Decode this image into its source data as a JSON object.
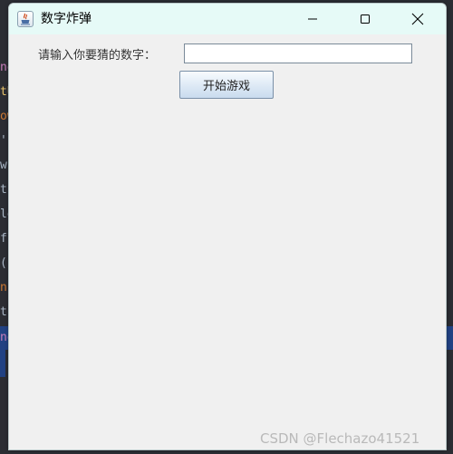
{
  "window": {
    "title": "数字炸弹",
    "minimize_label": "",
    "maximize_label": "",
    "close_label": ""
  },
  "form": {
    "prompt_label": "请输入你要猜的数字：",
    "guess_value": "",
    "start_button_label": "开始游戏"
  },
  "background_code_fragments": [
    "ne",
    "tU",
    "ow",
    "'",
    "w",
    "t",
    "le",
    "fl",
    "(",
    "n",
    "t",
    "ne"
  ],
  "watermark": "CSDN @Flechazo41521",
  "icons": {
    "app": "java-cup-icon",
    "minimize": "minimize-icon",
    "maximize": "maximize-icon",
    "close": "close-icon"
  },
  "colors": {
    "titlebar": "#e6faf7",
    "window_bg": "#f0f0f0",
    "ide_bg": "#2b2d33",
    "ide_highlight": "#214283"
  }
}
